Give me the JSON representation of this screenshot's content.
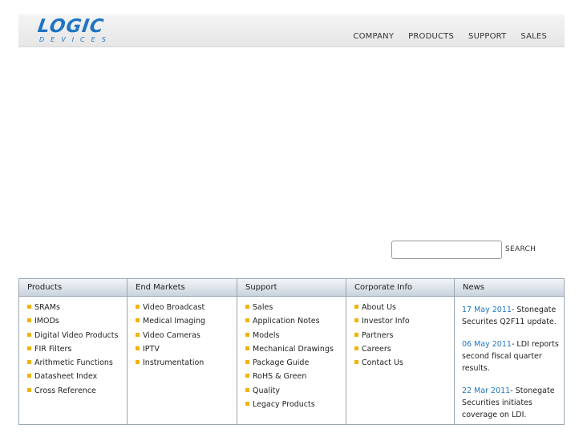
{
  "logo": {
    "word": "LOGIC",
    "sub": "DEVICES"
  },
  "nav": [
    "COMPANY",
    "PRODUCTS",
    "SUPPORT",
    "SALES"
  ],
  "search": {
    "button": "SEARCH",
    "placeholder": ""
  },
  "columns": {
    "products": {
      "title": "Products",
      "items": [
        "SRAMs",
        "IMODs",
        "Digital Video Products",
        "FIR Filters",
        "Arithmetic Functions",
        "Datasheet Index",
        "Cross Reference"
      ]
    },
    "markets": {
      "title": "End Markets",
      "items": [
        "Video Broadcast",
        "Medical Imaging",
        "Video Cameras",
        "IPTV",
        "Instrumentation"
      ]
    },
    "support": {
      "title": "Support",
      "items": [
        "Sales",
        "Application Notes",
        "Models",
        "Mechanical Drawings",
        "Package Guide",
        "RoHS & Green",
        "Quality",
        "Legacy Products"
      ]
    },
    "corporate": {
      "title": "Corporate Info",
      "items": [
        "About Us",
        "Investor Info",
        "Partners",
        "Careers",
        "Contact Us"
      ]
    },
    "news": {
      "title": "News",
      "items": [
        {
          "date": "17 May 2011",
          "text": "- Stonegate Securites Q2F11 update."
        },
        {
          "date": "06 May 2011",
          "text": "- LDI reports second fiscal quarter results."
        },
        {
          "date": "22 Mar 2011",
          "text": "- Stonegate Securities initiates coverage on LDI."
        }
      ]
    }
  },
  "colors": {
    "brand": "#1f74c4",
    "bullet": "#f0b400",
    "border": "#9aa6b2"
  }
}
